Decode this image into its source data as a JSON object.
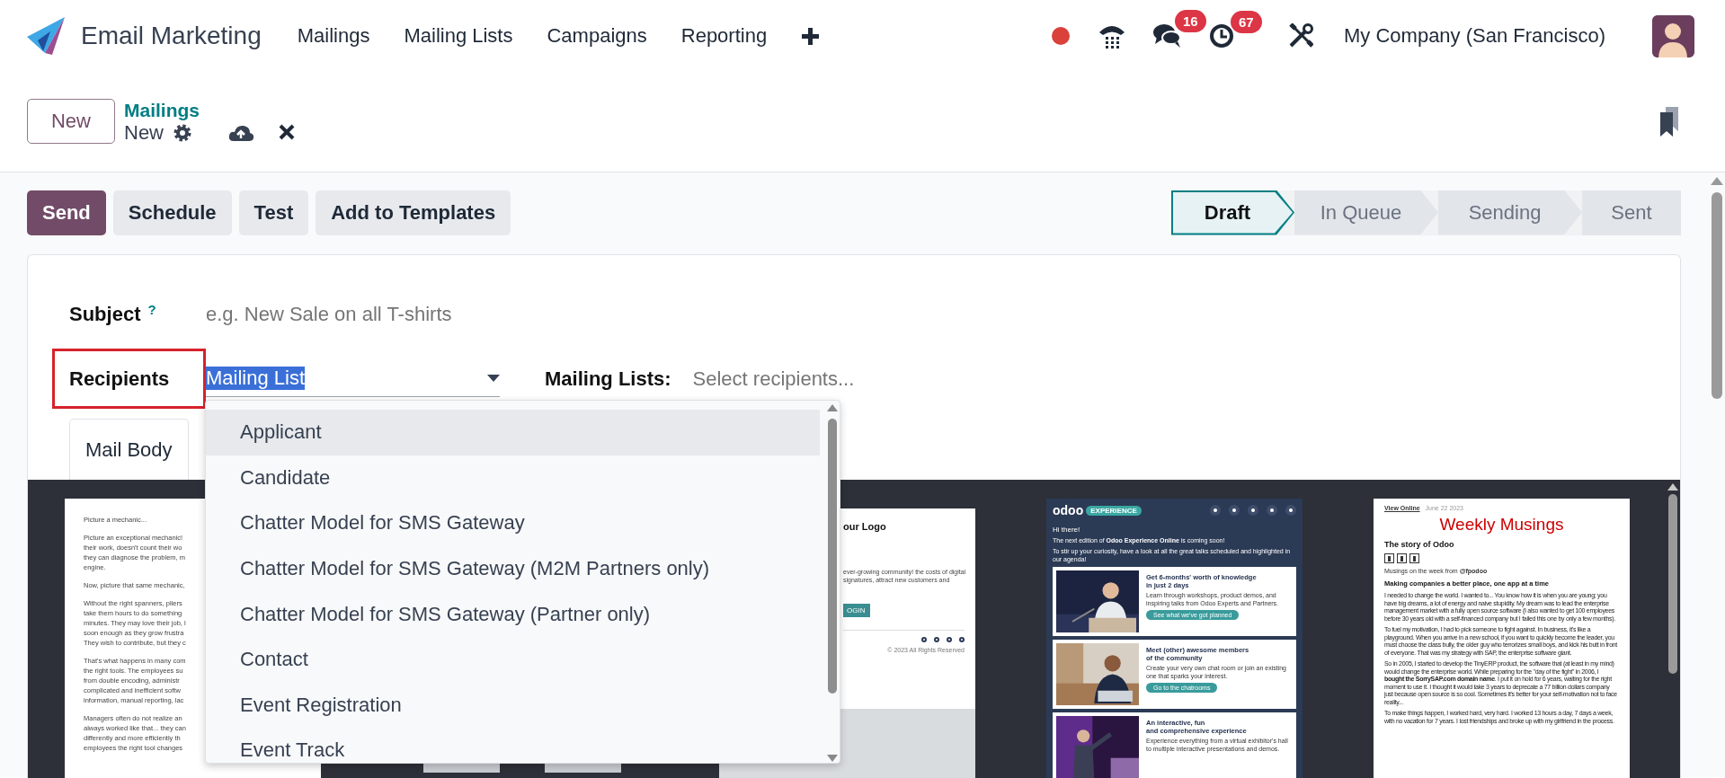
{
  "navbar": {
    "app_name": "Email Marketing",
    "menu": [
      "Mailings",
      "Mailing Lists",
      "Campaigns",
      "Reporting"
    ],
    "badges": [
      {
        "kind": "chat",
        "count": "16"
      },
      {
        "kind": "activity",
        "count": "67"
      }
    ],
    "company": "My Company (San Francisco)"
  },
  "control_panel": {
    "new_button": "New",
    "breadcrumb_parent": "Mailings",
    "record_name": "New"
  },
  "actions": [
    {
      "label": "Send",
      "primary": true
    },
    {
      "label": "Schedule",
      "primary": false
    },
    {
      "label": "Test",
      "primary": false
    },
    {
      "label": "Add to Templates",
      "primary": false
    }
  ],
  "stages": [
    {
      "label": "Draft",
      "selected": true
    },
    {
      "label": "In Queue",
      "selected": false
    },
    {
      "label": "Sending",
      "selected": false
    },
    {
      "label": "Sent",
      "selected": false
    }
  ],
  "form": {
    "subject": {
      "label": "Subject",
      "help": "?",
      "placeholder": "e.g. New Sale on all T-shirts"
    },
    "recipients": {
      "label": "Recipients",
      "highlighted": true,
      "value": "Mailing List",
      "value_selected": true
    },
    "mailing_lists": {
      "label": "Mailing Lists:",
      "placeholder": "Select recipients..."
    },
    "tabs": [
      {
        "label": "Mail Body",
        "selected": true
      }
    ]
  },
  "dropdown": {
    "options": [
      {
        "label": "Applicant",
        "selected": true
      },
      {
        "label": "Candidate",
        "selected": false
      },
      {
        "label": "Chatter Model for SMS Gateway",
        "selected": false
      },
      {
        "label": "Chatter Model for SMS Gateway (M2M Partners only)",
        "selected": false
      },
      {
        "label": "Chatter Model for SMS Gateway (Partner only)",
        "selected": false
      },
      {
        "label": "Contact",
        "selected": false
      },
      {
        "label": "Event Registration",
        "selected": false
      },
      {
        "label": "Event Track",
        "selected": false
      }
    ]
  },
  "templates": [
    {
      "kind": "text",
      "paragraphs": [
        "Picture a mechanic...",
        "Picture an exceptional mechanic!\ntheir work, doesn't count their wo\nthey can diagnose the problem, m\nengine.",
        "Now, picture that same mechanic,",
        "Without the right spanners, pliers\ntake them hours to do something\nminutes. They may love their job, l\nsoon enough as they grow frustra\nThey wish to contribute, but they c",
        "That's what happens in many com\nthe right tools. The employees su\nfrom double encoding, administr\ncomplicated and inefficient softw\ninformation, manual reporting, lac",
        "Managers often do not realize an\nalways worked like that... they can\ndifferently and more efficiently th\nemployees the right tool changes"
      ]
    },
    {
      "kind": "hidden"
    },
    {
      "kind": "logo",
      "title": "our Logo",
      "lines": "ever-growing community!\nthe costs of digital signatures, attract new customers and",
      "button": "OGIN",
      "footer": "© 2023 All Rights Reserved"
    },
    {
      "kind": "event",
      "badge": "EXPERIENCE",
      "logo": "odoo",
      "greeting": "Hi there!",
      "intro": [
        "The next edition of **Odoo Experience Online** is coming soon!",
        "To stir up your curiosity, have a look at all the great talks scheduled and highlighted in our agenda!"
      ],
      "cards": [
        {
          "title": "Get 6-months' worth of knowledge\nin just 2 days",
          "text": "Learn through workshops, product demos, and inspiring talks from Odoo Experts and Partners.",
          "button": "See what we've got planned"
        },
        {
          "title": "Meet (other) awesome members\nof the community",
          "text": "Create your very own chat room or join an existing one that sparks your interest.",
          "button": "Go to the chatrooms"
        },
        {
          "title": "An interactive, fun\nand comprehensive experience",
          "text": "Experience everything from a virtual exhibitor's hall to multiple interactive presentations and demos."
        }
      ]
    },
    {
      "kind": "newsletter",
      "view_online": "View Online",
      "date": "June 22 2023",
      "title": "Weekly Musings",
      "subtitle": "The story of Odoo",
      "byline": "Musings on the week from **@fpodoo**",
      "heading": "Making companies a better place, one app at a time",
      "paragraphs": [
        "I needed to change the world. I wanted to... You know how it is when you are young; you have big dreams, a lot of energy and naive stupidity. My dream was to lead the enterprise management market with a fully open source software (I also wanted to get 100 employees before 30 years old with a self-financed company but I failed this one by only a few months).",
        "To fuel my motivation, I had to pick someone to fight against. In business, it's like a playground. When you arrive in a new school, if you want to quickly become the leader, you must choose the class bully, the older guy who terrorizes small boys, and kick his butt in front of everyone. That was my strategy with SAP, the enterprise software giant.",
        "So in 2005, I started to develop the TinyERP product, the software that (at least in my mind) would change the enterprise world. While preparing for the \"day of the fight\" in 2006, I **bought the SorrySAP.com domain name**. I put it on hold for 6 years, waiting for the right moment to use it. I thought it would take 3 years to deprecate a 77 billion dollars company just because open source is so cool. Sometimes it's better for your self-motivation not to face reality...",
        "To make things happen, I worked hard, very hard. I worked 13 hours a day, 7 days a week, with no vacation for 7 years. I lost friendships and broke up with my girlfriend in the process."
      ]
    }
  ]
}
